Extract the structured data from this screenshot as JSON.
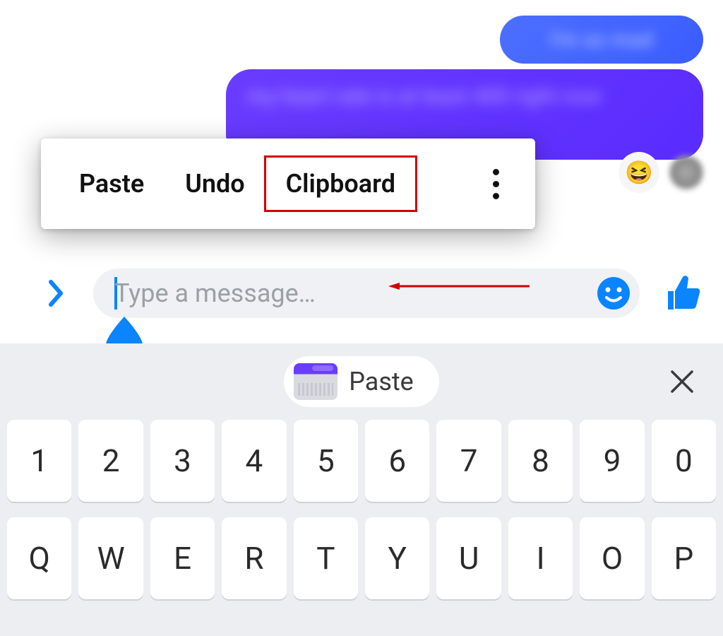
{
  "chat": {
    "bubble1_blurred_text": "I'm so mad",
    "bubble2_blurred_text": "my heart rate is at least 400 right now",
    "reaction_emoji": "😆"
  },
  "context_menu": {
    "paste": "Paste",
    "undo": "Undo",
    "clipboard": "Clipboard"
  },
  "input": {
    "placeholder": "Type a message…",
    "value": ""
  },
  "keyboard": {
    "paste_chip": "Paste",
    "row1": [
      "1",
      "2",
      "3",
      "4",
      "5",
      "6",
      "7",
      "8",
      "9",
      "0"
    ],
    "row2": [
      "Q",
      "W",
      "E",
      "R",
      "T",
      "Y",
      "U",
      "I",
      "O",
      "P"
    ]
  },
  "colors": {
    "accent_blue": "#0a84ff",
    "bubble_purple": "#6a3cff",
    "bubble_blue": "#3a5cff",
    "highlight_red": "#d00000"
  },
  "icons": {
    "chevron": "chevron-right-icon",
    "emoji": "smiley-icon",
    "thumb": "thumbs-up-icon",
    "more": "more-vertical-icon",
    "close": "close-icon",
    "avatar": "avatar-icon",
    "teardrop": "text-selection-handle-icon",
    "arrow": "annotation-arrow-icon"
  }
}
